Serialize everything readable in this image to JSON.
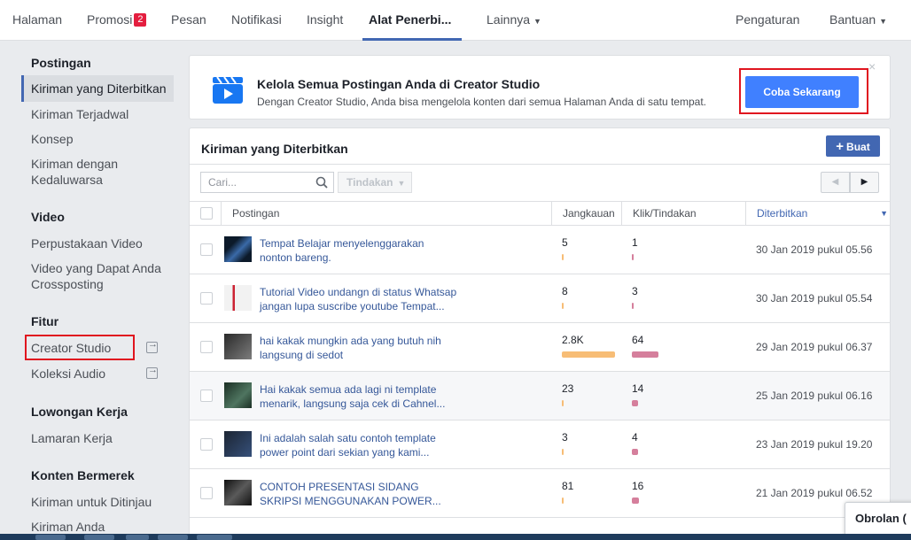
{
  "topnav": {
    "items": [
      {
        "label": "Halaman"
      },
      {
        "label": "Promosi",
        "badge": "2"
      },
      {
        "label": "Pesan"
      },
      {
        "label": "Notifikasi"
      },
      {
        "label": "Insight"
      },
      {
        "label": "Alat Penerbi..."
      },
      {
        "label": "Lainnya"
      }
    ],
    "settings": "Pengaturan",
    "help": "Bantuan"
  },
  "sidebar": {
    "sections": [
      {
        "heading": "Postingan"
      },
      {
        "heading": "Video"
      },
      {
        "heading": "Fitur"
      },
      {
        "heading": "Lowongan Kerja"
      },
      {
        "heading": "Konten Bermerek"
      }
    ],
    "items": [
      {
        "label": "Kiriman yang Diterbitkan"
      },
      {
        "label": "Kiriman Terjadwal"
      },
      {
        "label": "Konsep"
      },
      {
        "label": "Kiriman dengan Kedaluwarsa"
      },
      {
        "label": "Perpustakaan Video"
      },
      {
        "label": "Video yang Dapat Anda Crossposting"
      },
      {
        "label": "Creator Studio"
      },
      {
        "label": "Koleksi Audio"
      },
      {
        "label": "Lamaran Kerja"
      },
      {
        "label": "Kiriman untuk Ditinjau"
      },
      {
        "label": "Kiriman Anda"
      }
    ]
  },
  "banner": {
    "title": "Kelola Semua Postingan Anda di Creator Studio",
    "description": "Dengan Creator Studio, Anda bisa mengelola konten dari semua Halaman Anda di satu tempat.",
    "button": "Coba Sekarang",
    "close": "×"
  },
  "panel": {
    "title": "Kiriman yang Diterbitkan",
    "create_button": "Buat",
    "search_placeholder": "Cari...",
    "action_button": "Tindakan",
    "columns": {
      "post": "Postingan",
      "reach": "Jangkauan",
      "clicks": "Klik/Tindakan",
      "published": "Diterbitkan"
    },
    "rows": [
      {
        "title": "Tempat Belajar menyelenggarakan nonton bareng.",
        "reach": "5",
        "reach_frac": 0.0,
        "clicks": "1",
        "clicks_frac": 0.0,
        "date": "30 Jan 2019 pukul 05.56"
      },
      {
        "title": "Tutorial Video undangn di status Whatsap jangan lupa suscribe youtube Tempat...",
        "reach": "8",
        "reach_frac": 0.0,
        "clicks": "3",
        "clicks_frac": 0.0,
        "date": "30 Jan 2019 pukul 05.54"
      },
      {
        "title": "hai kakak mungkin ada yang butuh nih langsung di sedot",
        "reach": "2.8K",
        "reach_frac": 1.0,
        "clicks": "64",
        "clicks_frac": 1.0,
        "date": "29 Jan 2019 pukul 06.37"
      },
      {
        "title": "Hai kakak semua ada lagi ni template menarik, langsung saja cek di Cahnel...",
        "reach": "23",
        "reach_frac": 0.01,
        "clicks": "14",
        "clicks_frac": 0.22,
        "date": "25 Jan 2019 pukul 06.16"
      },
      {
        "title": "Ini adalah salah satu contoh template power point dari sekian yang kami...",
        "reach": "3",
        "reach_frac": 0.0,
        "clicks": "4",
        "clicks_frac": 0.06,
        "date": "23 Jan 2019 pukul 19.20"
      },
      {
        "title": "CONTOH PRESENTASI SIDANG SKRIPSI MENGGUNAKAN POWER...",
        "reach": "81",
        "reach_frac": 0.03,
        "clicks": "16",
        "clicks_frac": 0.25,
        "date": "21 Jan 2019 pukul 06.52"
      }
    ]
  },
  "chat": {
    "label": "Obrolan ("
  },
  "colors": {
    "accent": "#4267b2",
    "button_blue": "#4080ff",
    "reach_bar": "#f7bd76",
    "clicks_bar": "#d57f9c",
    "highlight_red": "#e0151f"
  }
}
